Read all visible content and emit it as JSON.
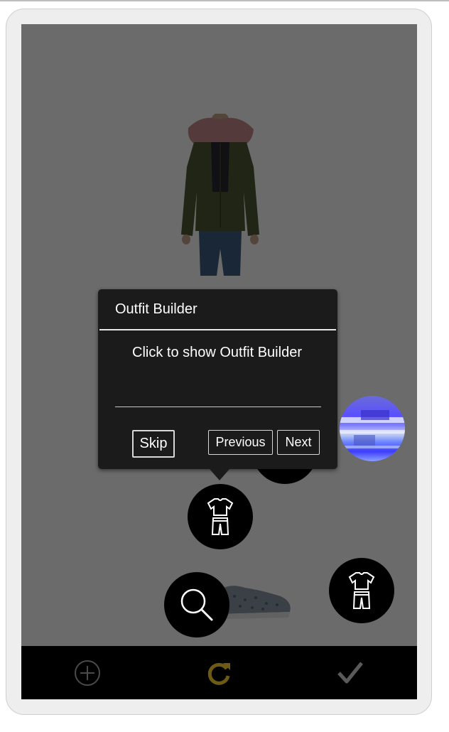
{
  "tooltip": {
    "title": "Outfit Builder",
    "body": "Click to show Outfit Builder",
    "skip_label": "Skip",
    "previous_label": "Previous",
    "next_label": "Next"
  },
  "canvas_items": [
    {
      "name": "jacket",
      "icon": "olive-parka-with-fur-hood"
    },
    {
      "name": "shorts",
      "icon": "striped-shorts"
    },
    {
      "name": "shoe",
      "icon": "glitter-sneaker"
    }
  ],
  "floating_buttons": [
    {
      "name": "outfit-builder",
      "icon": "outfit-icon"
    },
    {
      "name": "outfit-builder-side",
      "icon": "outfit-icon"
    },
    {
      "name": "search",
      "icon": "search-icon"
    },
    {
      "name": "profile",
      "icon": "avatar"
    }
  ],
  "action_bar": {
    "add_icon": "plus-circle-icon",
    "refresh_icon": "refresh-icon",
    "done_icon": "check-icon"
  },
  "colors": {
    "overlay": "#000000",
    "tooltip_bg": "#1b1b1b",
    "refresh_accent": "#c9a316",
    "bar_icon": "#8a8a8a"
  }
}
